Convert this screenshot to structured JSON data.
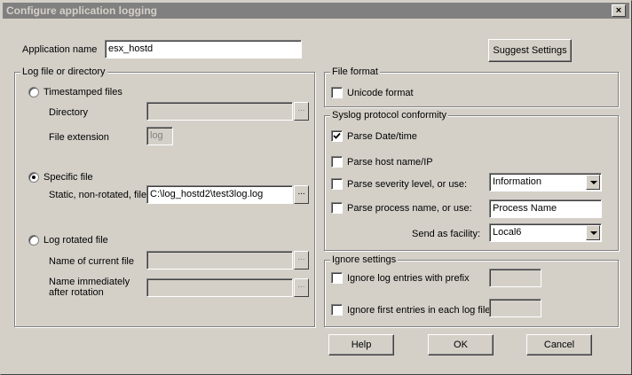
{
  "window": {
    "title": "Configure application logging",
    "close_glyph": "×"
  },
  "app": {
    "label": "Application name",
    "value": "esx_hostd"
  },
  "suggest_button": "Suggest Settings",
  "log_group": {
    "title": "Log file or directory",
    "timestamped": {
      "label": "Timestamped files",
      "directory_label": "Directory",
      "directory_value": "",
      "extension_label": "File extension",
      "extension_value": "log"
    },
    "specific": {
      "label": "Specific file",
      "static_label": "Static, non-rotated, file",
      "static_value": "C:\\log_hostd2\\test3log.log"
    },
    "rotated": {
      "label": "Log rotated file",
      "current_label": "Name of current file",
      "current_value": "",
      "after_label_1": "Name immediately",
      "after_label_2": "after rotation",
      "after_value": ""
    },
    "selected": "specific",
    "browse_glyph": "..."
  },
  "format_group": {
    "title": "File format",
    "unicode_label": "Unicode format",
    "unicode_checked": false
  },
  "syslog_group": {
    "title": "Syslog protocol conformity",
    "parse_date_label": "Parse Date/time",
    "parse_date_checked": true,
    "parse_host_label": "Parse host name/IP",
    "parse_host_checked": false,
    "parse_severity_label": "Parse severity level, or use:",
    "parse_severity_checked": false,
    "severity_value": "Information",
    "parse_process_label": "Parse process name, or use:",
    "parse_process_checked": false,
    "process_value": "Process Name",
    "facility_label": "Send as facility:",
    "facility_value": "Local6"
  },
  "ignore_group": {
    "title": "Ignore settings",
    "prefix_label": "Ignore log entries with prefix",
    "prefix_checked": false,
    "prefix_value": "",
    "first_label": "Ignore first entries in each log file",
    "first_checked": false,
    "first_value": ""
  },
  "buttons": {
    "help": "Help",
    "ok": "OK",
    "cancel": "Cancel"
  }
}
